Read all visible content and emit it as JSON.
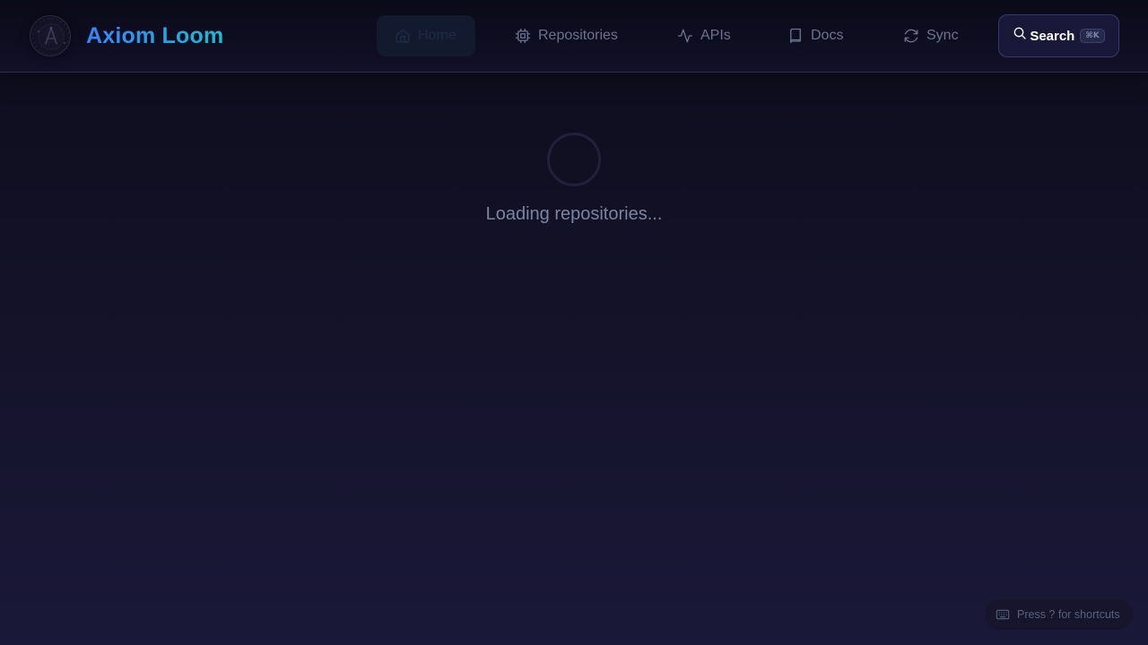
{
  "app": {
    "brand": "Axiom Loom",
    "logo_icon": "axiom-loom-logo",
    "accent_gradient": [
      "#3b82f6",
      "#22b8cf"
    ]
  },
  "nav": {
    "items": [
      {
        "label": "Home",
        "icon": "home-icon",
        "active": true
      },
      {
        "label": "Repositories",
        "icon": "cpu-chip-icon",
        "active": false
      },
      {
        "label": "APIs",
        "icon": "activity-pulse-icon",
        "active": false
      },
      {
        "label": "Docs",
        "icon": "book-icon",
        "active": false
      },
      {
        "label": "Sync",
        "icon": "refresh-icon",
        "active": false
      }
    ]
  },
  "search": {
    "label": "Search",
    "shortcut": "⌘K",
    "icon": "search-icon"
  },
  "main": {
    "loading_text": "Loading repositories..."
  },
  "footer_hint": {
    "text": "Press ? for shortcuts",
    "icon": "keyboard-icon"
  }
}
